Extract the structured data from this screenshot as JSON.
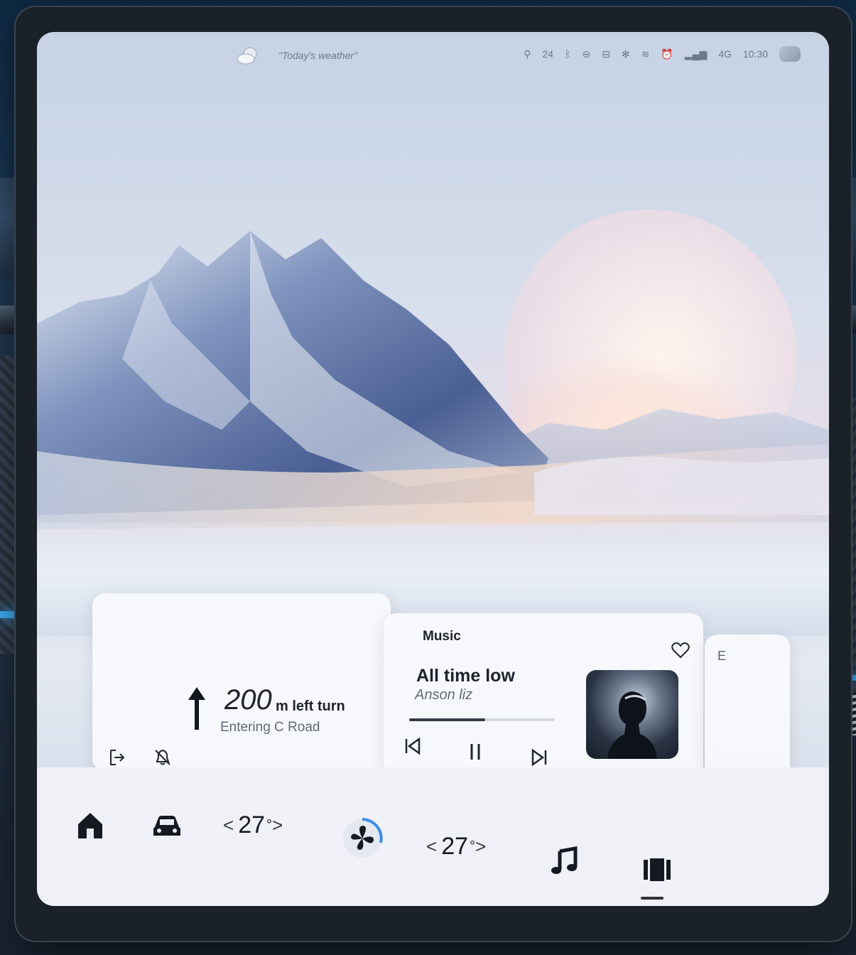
{
  "status_bar": {
    "weather_label": "\"Today's weather\"",
    "indicators": [
      "24",
      "4G",
      "10:30"
    ],
    "clock": "10:30",
    "network": "4G",
    "aqi": "24"
  },
  "navigation_card": {
    "distance": "200",
    "instruction": "m left turn",
    "road": "Entering C Road"
  },
  "music_card": {
    "label": "Music",
    "song_title": "All time low",
    "artist": "Anson liz",
    "progress": 0.52
  },
  "third_card": {
    "label": "E"
  },
  "dock": {
    "temp_left": "27",
    "temp_right": "27",
    "chevron_left": "<",
    "chevron_right": ">",
    "degree": "°"
  },
  "colors": {
    "accent": "#3a8ee6",
    "text_primary": "#1d222b",
    "text_secondary": "#616b79",
    "ambient_light": "#3fb3ff"
  },
  "icons": [
    "weather-icon",
    "search-icon",
    "bluetooth-icon",
    "wheel-icon",
    "seat-icon",
    "fan-mini-icon",
    "wifi-icon",
    "alarm-icon",
    "signal-icon",
    "avatar",
    "up-arrow-icon",
    "exit-icon",
    "mute-icon",
    "heart-icon",
    "prev-icon",
    "pause-icon",
    "next-icon",
    "home-icon",
    "car-icon",
    "fan-icon",
    "music-note-icon",
    "apps-icon"
  ]
}
